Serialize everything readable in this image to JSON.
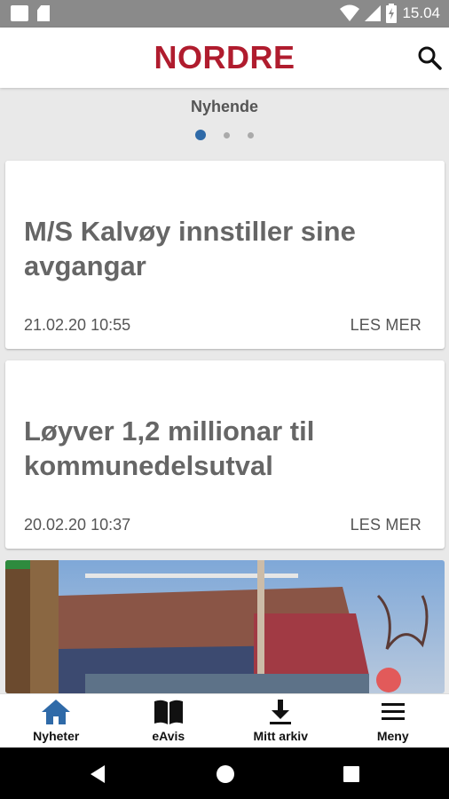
{
  "status_bar": {
    "time": "15.04"
  },
  "header": {
    "brand": "NORDRE"
  },
  "section": {
    "title": "Nyhende",
    "page_count": 3,
    "active_page": 1
  },
  "articles": [
    {
      "title_line1": "M/S Kalvøy innstiller sine",
      "title_line2": "avgangar",
      "date": "21.02.20 10:55",
      "more": "LES MER"
    },
    {
      "title_line1": "Løyver 1,2 millionar til",
      "title_line2": "kommunedelsutval",
      "date": "20.02.20 10:37",
      "more": "LES MER"
    }
  ],
  "bottom_nav": [
    {
      "label": "Nyheter",
      "icon": "home-icon",
      "active": true
    },
    {
      "label": "eAvis",
      "icon": "book-icon"
    },
    {
      "label": "Mitt arkiv",
      "icon": "download-icon"
    },
    {
      "label": "Meny",
      "icon": "menu-icon"
    }
  ],
  "colors": {
    "brand": "#b01c2e",
    "accent": "#2f6aa8"
  }
}
